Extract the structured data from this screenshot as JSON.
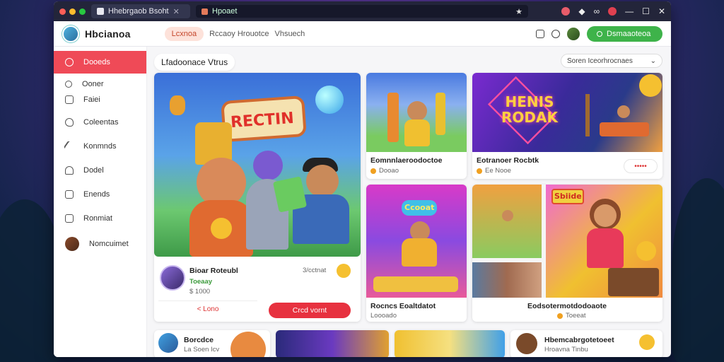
{
  "browser": {
    "tab_title": "Hhebrgaob Bsoht",
    "tab2_title": "Hpoaet",
    "address": "Hpoaet",
    "dot_colors": [
      "#ff5f57",
      "#febc2e",
      "#28c840"
    ]
  },
  "app": {
    "brand": "Hbcianoa",
    "nav": {
      "active": "Lcxnoa",
      "links": [
        "Rccaoy Hrouotce",
        "Vhsuech"
      ]
    },
    "cta_label": "Dsmaaoteoa"
  },
  "sidebar": {
    "items": [
      {
        "label": "Dooeds",
        "icon": "home-icon"
      },
      {
        "label": "Ooner",
        "icon": "image-icon"
      },
      {
        "label": "Faiei",
        "icon": "calendar-icon"
      },
      {
        "label": "Coleentas",
        "icon": "heart-icon"
      },
      {
        "label": "Konmnds",
        "icon": "pen-icon"
      },
      {
        "label": "Dodel",
        "icon": "bell-icon"
      },
      {
        "label": "Enends",
        "icon": "document-icon"
      },
      {
        "label": "Ronmiat",
        "icon": "clipboard-icon"
      },
      {
        "label": "Nomcuimet",
        "icon": "avatar"
      }
    ]
  },
  "main": {
    "section_title": "Lfadoonace Vtrus",
    "sort": {
      "selected": "Soren Iceorhrocnaes"
    },
    "featured": {
      "banner": "RECTIN",
      "creator": "Bioar Roteubl",
      "badge": "3/cctnat",
      "meta_green": "Toeaay",
      "price": "$ 1000",
      "secondary_button": "< Lono",
      "primary_button": "Crcd vornt"
    },
    "cards": [
      {
        "title": "Eomnnlaeroodoctoe",
        "meta": "Dooao"
      },
      {
        "title": "Eotranoer Rocbtk",
        "meta": "Ee Nooe",
        "button": "•••••",
        "banner": "HENIS RODAK"
      },
      {
        "title": "Rocncs Eoaltdatot",
        "meta": "Loooado",
        "banner": "Ccooat"
      },
      {
        "title": "Eodsotermotdodoaote",
        "meta": "Toeeat",
        "banner": "Sbiide"
      }
    ],
    "bottom": [
      {
        "title": "Borcdce",
        "meta": "La Soen Icv"
      },
      {
        "title": "Hbemcabrgotetoeet",
        "meta": "Hroavna Tinbu"
      }
    ]
  }
}
